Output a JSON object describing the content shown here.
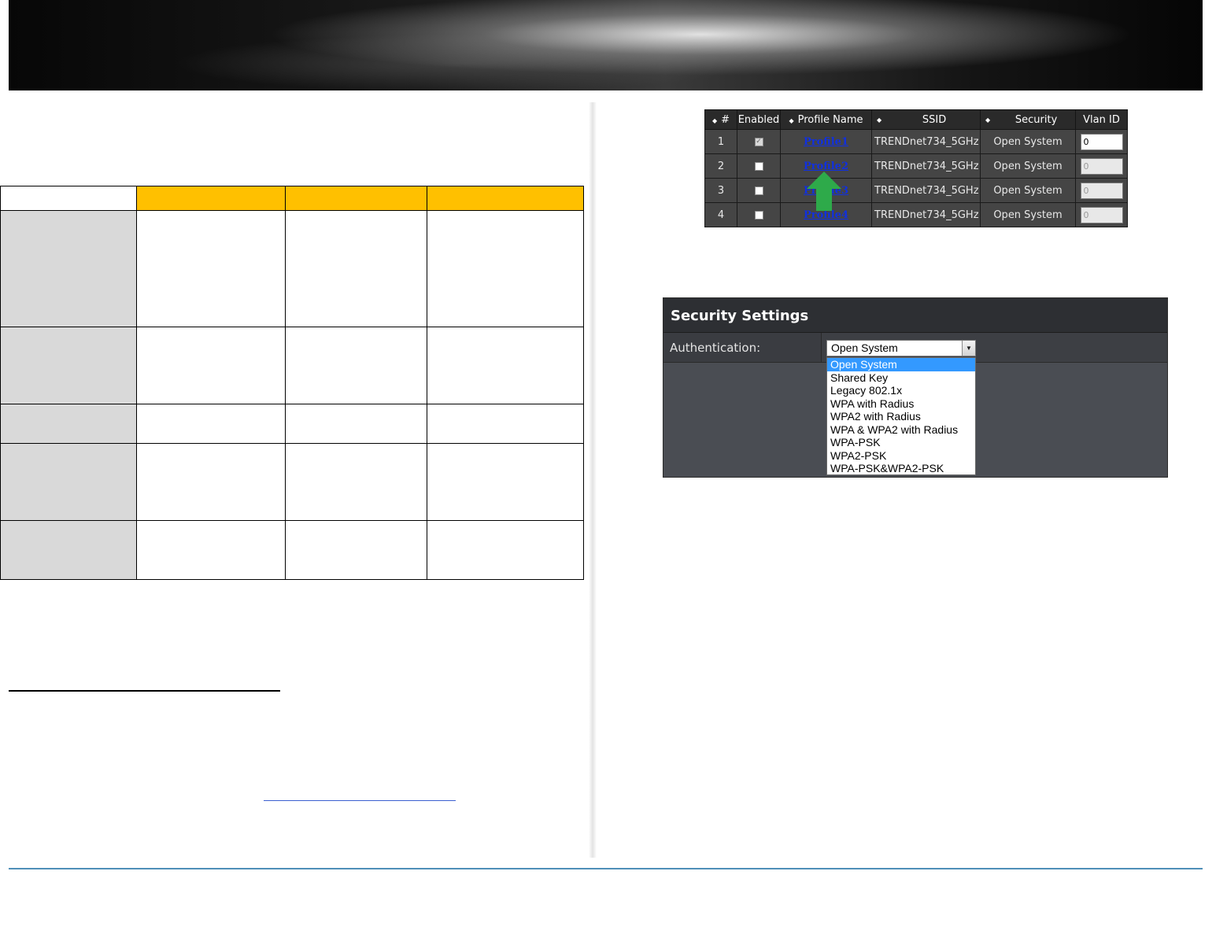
{
  "profile_table": {
    "headers": [
      "#",
      "Enabled",
      "Profile Name",
      "SSID",
      "Security",
      "Vlan ID"
    ],
    "rows": [
      {
        "num": "1",
        "enabled": true,
        "profile": "Profile1",
        "ssid": "TRENDnet734_5GHz",
        "security": "Open System",
        "vlan": "0"
      },
      {
        "num": "2",
        "enabled": false,
        "profile": "Profile2",
        "ssid": "TRENDnet734_5GHz",
        "security": "Open System",
        "vlan": "0"
      },
      {
        "num": "3",
        "enabled": false,
        "profile": "Profile3",
        "ssid": "TRENDnet734_5GHz",
        "security": "Open System",
        "vlan": "0"
      },
      {
        "num": "4",
        "enabled": false,
        "profile": "Profile4",
        "ssid": "TRENDnet734_5GHz",
        "security": "Open System",
        "vlan": "0"
      }
    ]
  },
  "security_settings": {
    "title": "Security Settings",
    "auth_label": "Authentication:",
    "selected": "Open System",
    "options": [
      "Open System",
      "Shared Key",
      "Legacy 802.1x",
      "WPA with Radius",
      "WPA2 with Radius",
      "WPA & WPA2 with Radius",
      "WPA-PSK",
      "WPA2-PSK",
      "WPA-PSK&WPA2-PSK"
    ]
  },
  "colors": {
    "table_header": "#ffc000",
    "row_header": "#d9d9d9",
    "footer_line": "#4f8fb8",
    "arrow": "#2eaa4a",
    "selected_option": "#3399ff"
  }
}
